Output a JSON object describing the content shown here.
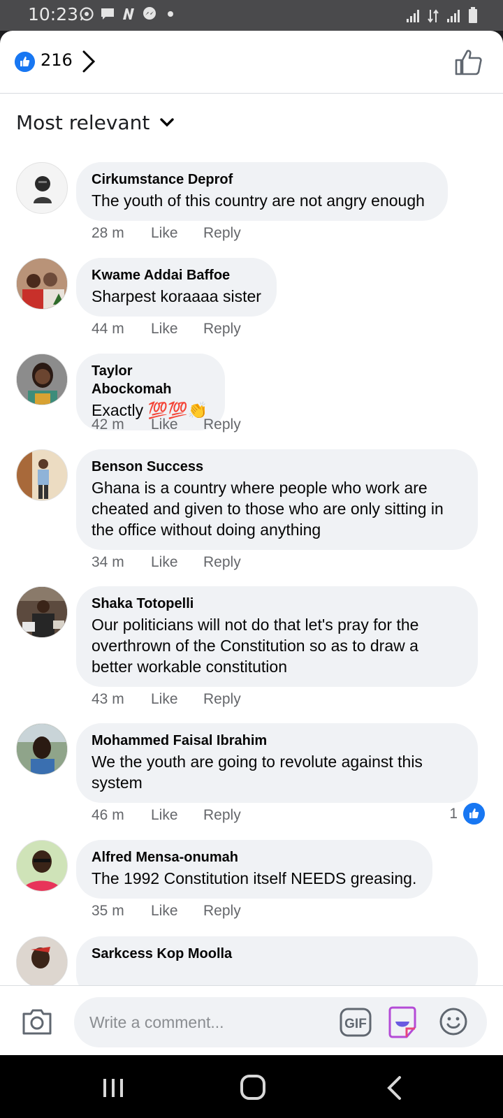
{
  "status_bar": {
    "time": "10:23",
    "left_icons": [
      "whatsapp-icon",
      "message-icon",
      "n-app-icon",
      "messenger-icon",
      "dot-icon"
    ],
    "right_icons": [
      "signal-icon",
      "data-arrows-icon",
      "signal-icon",
      "battery-icon"
    ]
  },
  "header": {
    "reaction_count": "216",
    "accent_color": "#1877f2"
  },
  "sort": {
    "label": "Most relevant"
  },
  "comments": [
    {
      "author": "Cirkumstance Deprof",
      "text": "The youth of this country are not angry enough",
      "time": "28 m",
      "like_label": "Like",
      "reply_label": "Reply"
    },
    {
      "author": "Kwame Addai Baffoe",
      "text": "Sharpest koraaaa sister",
      "time": "44 m",
      "like_label": "Like",
      "reply_label": "Reply"
    },
    {
      "author": "Taylor Abockomah",
      "text": "Exactly 💯💯👏",
      "time": "42 m",
      "like_label": "Like",
      "reply_label": "Reply"
    },
    {
      "author": "Benson Success",
      "text": "Ghana is a country where people who work are cheated and given to those  who are only sitting in the office without doing anything",
      "time": "34 m",
      "like_label": "Like",
      "reply_label": "Reply"
    },
    {
      "author": "Shaka Totopelli",
      "text": "Our politicians will not do that let's pray for the overthrown of the Constitution so as to draw  a better workable constitution",
      "time": "43 m",
      "like_label": "Like",
      "reply_label": "Reply"
    },
    {
      "author": "Mohammed Faisal Ibrahim",
      "text": "We the youth are going to revolute against this system",
      "time": "46 m",
      "like_label": "Like",
      "reply_label": "Reply",
      "reaction_count": "1"
    },
    {
      "author": "Alfred Mensa-onumah",
      "text": "The 1992 Constitution itself NEEDS greasing.",
      "time": "35 m",
      "like_label": "Like",
      "reply_label": "Reply"
    },
    {
      "author": "Sarkcess Kop Moolla"
    }
  ],
  "composer": {
    "placeholder": "Write a comment..."
  }
}
